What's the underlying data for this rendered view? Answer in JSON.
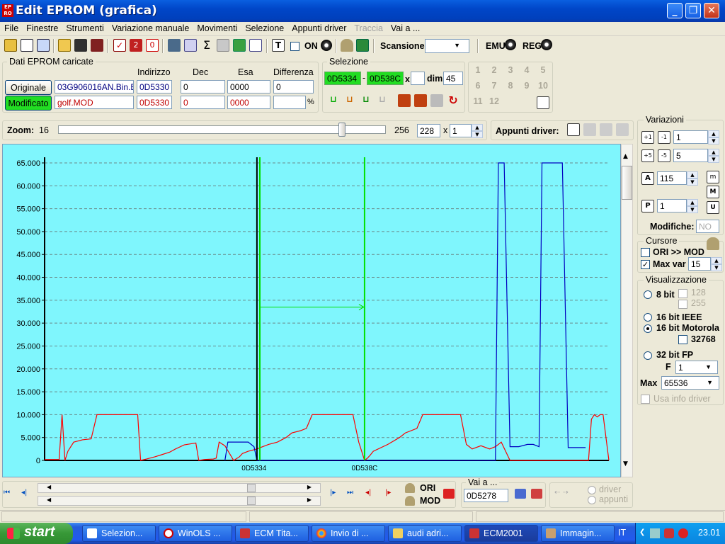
{
  "window": {
    "title": "Edit EPROM (grafica)",
    "app_icon": "eprom-app-icon",
    "buttons": [
      "minimize",
      "maximize",
      "close"
    ]
  },
  "menu": [
    "File",
    "Finestre",
    "Strumenti",
    "Variazione manuale",
    "Movimenti",
    "Selezione",
    "Appunti driver",
    "Traccia",
    "Vai a ..."
  ],
  "toolbar": {
    "on_label": "ON",
    "scansione_label": "Scansione",
    "scansione_value": "",
    "emu_label": "EMU",
    "reg_label": "REG"
  },
  "dati": {
    "title": "Dati EPROM caricate",
    "headers": {
      "indirizzo": "Indirizzo",
      "dec": "Dec",
      "esa": "Esa",
      "differenza": "Differenza"
    },
    "originale": {
      "label": "Originale",
      "file": "03G906016AN.Bin.Bin",
      "indirizzo": "0D5330",
      "dec": "0",
      "esa": "0000",
      "differenza": "0"
    },
    "modificato": {
      "label": "Modificato",
      "file": "golf.MOD",
      "indirizzo": "0D5330",
      "dec": "0",
      "esa": "0000",
      "differenza": "",
      "pct": "%"
    }
  },
  "selezione": {
    "title": "Selezione",
    "start": "0D5334",
    "dash": "-",
    "end": "0D538C",
    "x_label": "x",
    "x_value": "",
    "dim_label": "dim.",
    "dim_value": "45"
  },
  "numpad": [
    "1",
    "2",
    "3",
    "4",
    "5",
    "6",
    "7",
    "8",
    "9",
    "10",
    "11",
    "12"
  ],
  "zoom": {
    "label": "Zoom:",
    "min": "16",
    "max": "256",
    "value": "228",
    "x_label": "x",
    "multiplier": "1",
    "slider_level": 0.875
  },
  "appunti": {
    "label": "Appunti driver:"
  },
  "variazioni": {
    "title": "Variazioni",
    "step1": "1",
    "step2": "5",
    "a_value": "115",
    "p_value": "1",
    "modifiche_label": "Modifiche:",
    "modifiche_value": "NO",
    "icon_m": "m",
    "icon_M": "M",
    "icon_U": "U"
  },
  "cursore": {
    "title": "Cursore",
    "ori_mod": "ORI >> MOD",
    "ori_mod_checked": false,
    "maxvar_label": "Max var",
    "maxvar_checked": true,
    "maxvar_value": "15"
  },
  "visualizzazione": {
    "title": "Visualizzazione",
    "bit8": "8 bit",
    "v128": "128",
    "v255": "255",
    "ieee": "16 bit IEEE",
    "motorola": "16 bit Motorola",
    "v32768": "32768",
    "fp32": "32 bit FP",
    "f_label": "F",
    "f_value": "1",
    "max_label": "Max",
    "max_value": "65536",
    "usa_info": "Usa info driver",
    "selected": "16 bit Motorola"
  },
  "bottom": {
    "ori": "ORI",
    "mod": "MOD",
    "vai_title": "Vai a ...",
    "vai_value": "0D5278",
    "driver": "driver",
    "appunti": "appunti"
  },
  "chart_data": {
    "type": "line",
    "ylim": [
      0,
      65000
    ],
    "yticks": [
      "0",
      "5.000",
      "10.000",
      "15.000",
      "20.000",
      "25.000",
      "30.000",
      "35.000",
      "40.000",
      "45.000",
      "50.000",
      "55.000",
      "60.000",
      "65.000"
    ],
    "xticks": [
      "0D5334",
      "0D538C"
    ],
    "colors": {
      "modificato": "#ff0000",
      "originale": "#0000c0",
      "cursor": "#000000",
      "selection": "#00e000",
      "background": "#80f8ff"
    },
    "series": [
      {
        "key": "mod",
        "color": "#ff0000",
        "x": [
          0,
          1,
          5,
          6,
          7,
          8,
          10,
          13,
          16,
          18,
          19,
          20,
          25,
          31,
          32,
          33,
          35,
          38,
          40,
          43,
          45,
          48,
          52,
          53,
          55,
          58,
          59,
          60,
          62,
          65,
          67,
          68,
          70,
          73,
          75,
          77,
          80,
          83,
          85,
          88,
          90,
          92,
          94,
          95,
          97,
          100,
          102,
          104,
          106,
          108,
          110,
          111,
          112,
          113,
          118,
          122,
          124,
          128,
          130,
          134,
          139,
          141,
          143,
          145,
          147,
          150,
          153,
          155,
          157,
          160,
          163,
          166,
          168,
          170,
          171,
          174,
          178,
          185,
          187,
          188,
          189,
          190,
          191,
          192,
          194
        ],
        "y": [
          200,
          200,
          200,
          10000,
          0,
          2000,
          4000,
          4500,
          4700,
          10000,
          10000,
          10000,
          10000,
          10000,
          10000,
          0,
          300,
          800,
          1200,
          1800,
          2500,
          3400,
          3800,
          0,
          200,
          300,
          500,
          4000,
          3200,
          0,
          800,
          1500,
          2000,
          2500,
          3000,
          3500,
          4000,
          5000,
          6000,
          6500,
          7000,
          10000,
          10000,
          10000,
          10000,
          10000,
          10000,
          10000,
          10000,
          4000,
          0,
          500,
          1200,
          2000,
          3500,
          5000,
          6000,
          7000,
          10000,
          10000,
          10000,
          10000,
          10000,
          3500,
          2500,
          3200,
          2500,
          3000,
          4000,
          0,
          0,
          0,
          0,
          0,
          0,
          0,
          0,
          0,
          0,
          9000,
          10000,
          9500,
          10000,
          10000,
          0
        ]
      },
      {
        "key": "ori",
        "color": "#0000c0",
        "x": [
          62,
          63,
          70,
          72,
          73,
          150,
          155,
          156,
          158,
          160,
          163,
          166,
          168,
          170,
          171,
          172,
          175,
          178,
          180,
          186
        ],
        "y": [
          0,
          4000,
          4000,
          3000,
          0,
          0,
          0,
          65000,
          65000,
          3000,
          3000,
          3500,
          3500,
          3000,
          65000,
          65000,
          65000,
          65000,
          2800,
          2800
        ]
      }
    ],
    "markers": {
      "cursor_x": 73,
      "selection_start": 74,
      "selection_end": 110,
      "arrow_y": 33500
    }
  },
  "taskbar": {
    "start": "start",
    "tasks": [
      "Selezion...",
      "WinOLS ...",
      "ECM Tita...",
      "Invio di ...",
      "audi adri...",
      "ECM2001",
      "Immagin..."
    ],
    "lang": "IT",
    "clock": "23.01"
  }
}
